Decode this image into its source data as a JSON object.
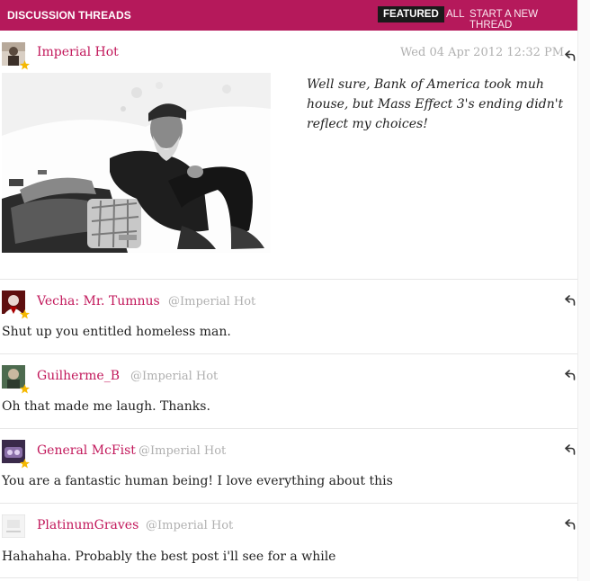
{
  "header": {
    "title": "DISCUSSION THREADS",
    "featured": "FEATURED",
    "all": "ALL",
    "start_thread": "START A NEW THREAD"
  },
  "op": {
    "author": "Imperial Hot",
    "date": "Wed 04 Apr 2012 12:32 PM",
    "text": "Well sure, Bank of America took muh house, but Mass Effect 3's ending didn't reflect my choices!"
  },
  "replies": [
    {
      "author": "Vecha: Mr. Tumnus",
      "mention": "@Imperial Hot",
      "text": "Shut up you entitled homeless man."
    },
    {
      "author": "Guilherme_B",
      "mention": "@Imperial Hot",
      "text": "Oh that made me laugh. Thanks."
    },
    {
      "author": "General McFist",
      "mention": "@Imperial Hot",
      "text": "You are a fantastic human being! I love everything about this"
    },
    {
      "author": "PlatinumGraves",
      "mention": "@Imperial Hot",
      "text": "Hahahaha. Probably the best post i'll see for a while"
    }
  ],
  "colors": {
    "brand": "#b5195b",
    "author": "#c2185b",
    "muted": "#b0b0b0"
  },
  "icons": {
    "reply": "reply-arrow-icon",
    "badge": "star-icon"
  }
}
